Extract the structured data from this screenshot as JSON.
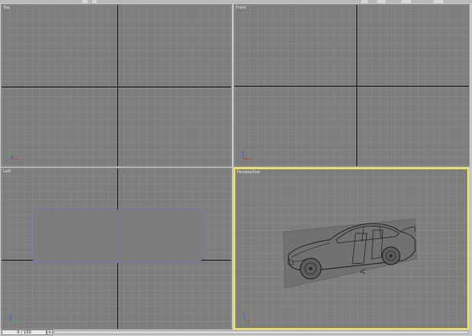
{
  "viewports": {
    "top": {
      "label": "Top"
    },
    "front": {
      "label": "Front"
    },
    "left": {
      "label": "Left"
    },
    "perspective": {
      "label": "Perspective",
      "active": true
    }
  },
  "statusbar": {
    "frame_counter": "0 / 100",
    "next_label": ">"
  },
  "colors": {
    "viewport_bg": "#7d7d7d",
    "active_border": "#f2e24a",
    "axis_line": "#1a1a1a",
    "frame_outline": "#7b6fb0"
  },
  "icons": {
    "axis_gizmo": "xyz-axis-icon",
    "object": "car-wireframe"
  }
}
